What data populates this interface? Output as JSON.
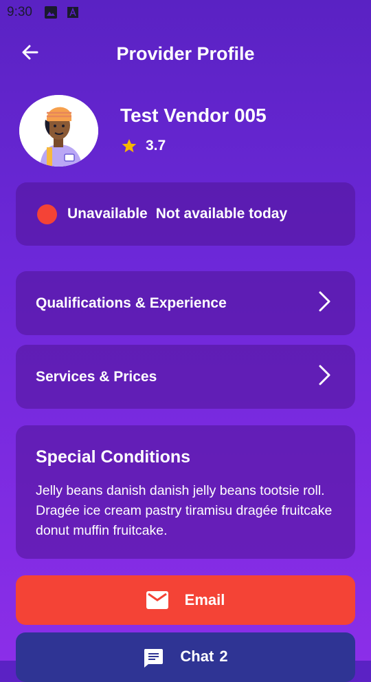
{
  "status_bar": {
    "time": "9:30",
    "icons": [
      "image-icon",
      "a-icon"
    ]
  },
  "app_bar": {
    "title": "Provider Profile",
    "back_icon": "arrow-left-icon"
  },
  "profile": {
    "name": "Test Vendor 005",
    "rating": "3.7",
    "star_color": "#f5b800"
  },
  "availability": {
    "status": "Unavailable",
    "note": "Not available today",
    "dot_color": "#f44336"
  },
  "sections": [
    {
      "label": "Qualifications & Experience"
    },
    {
      "label": "Services & Prices"
    }
  ],
  "special_conditions": {
    "title": "Special Conditions",
    "body": "Jelly beans danish danish jelly beans tootsie roll. Dragée ice cream pastry tiramisu dragée fruitcake donut muffin fruitcake."
  },
  "actions": {
    "email_label": "Email",
    "chat_label": "Chat",
    "chat_count": "2"
  },
  "colors": {
    "email": "#f44336",
    "chat": "#2f3494"
  }
}
